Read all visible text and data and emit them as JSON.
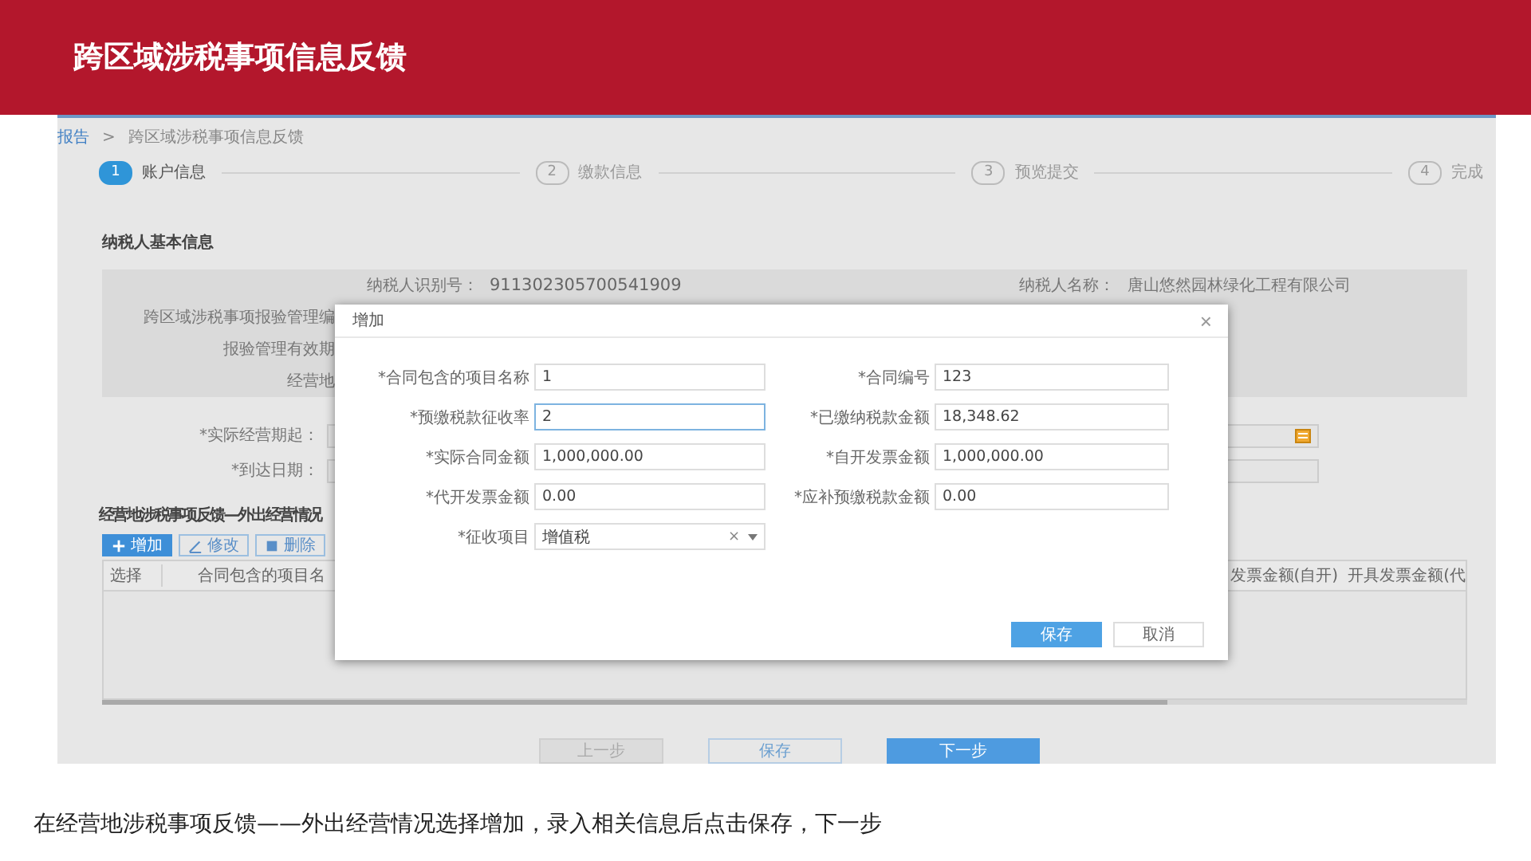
{
  "header": {
    "title": "跨区域涉税事项信息反馈"
  },
  "breadcrumb": {
    "parent": "报告",
    "separator": ">",
    "current": "跨区域涉税事项信息反馈"
  },
  "steps": [
    {
      "number": "1",
      "label": "账户信息",
      "selected": true
    },
    {
      "number": "2",
      "label": "缴款信息",
      "selected": false
    },
    {
      "number": "3",
      "label": "预览提交",
      "selected": false
    },
    {
      "number": "4",
      "label": "完成",
      "selected": false
    }
  ],
  "basic_info": {
    "title": "纳税人基本信息",
    "rows": [
      {
        "label": "纳税人识别号：",
        "value": "911302305700541909",
        "right_label": "纳税人名称：",
        "right_value": "唐山悠然园林绿化工程有限公司"
      },
      {
        "label": "跨区域涉税事项报验管理编"
      },
      {
        "label": "报验管理有效期"
      },
      {
        "label": "经营地"
      }
    ]
  },
  "date_fields": [
    {
      "label": "*实际经营期起：",
      "kind": "date"
    },
    {
      "label": "*到达日期：",
      "kind": "text"
    }
  ],
  "feedback": {
    "title": "经营地涉税事项反馈—外出经营情况",
    "toolbar": [
      {
        "label": "增加",
        "kind": "add"
      },
      {
        "label": "修改",
        "kind": "edit"
      },
      {
        "label": "删除",
        "kind": "delete"
      }
    ],
    "table": {
      "columns": [
        "选择",
        "合同包含的项目名",
        "发票金额(自开)",
        "开具发票金额(代"
      ]
    }
  },
  "footer_buttons": [
    {
      "label": "上一步",
      "kind": "secondary",
      "disabled": true
    },
    {
      "label": "保存",
      "kind": "secondary",
      "disabled": false
    },
    {
      "label": "下一步",
      "kind": "primary",
      "disabled": false
    }
  ],
  "dialog": {
    "title": "增加",
    "close": "×",
    "fields": [
      {
        "label": "*合同包含的项目名称",
        "value": "1",
        "kind": "input",
        "focused": false
      },
      {
        "label": "*合同编号",
        "value": "123",
        "kind": "input",
        "focused": false
      },
      {
        "label": "*预缴税款征收率",
        "value": "2",
        "kind": "input",
        "focused": true
      },
      {
        "label": "*已缴纳税款金额",
        "value": "18,348.62",
        "kind": "input",
        "focused": false
      },
      {
        "label": "*实际合同金额",
        "value": "1,000,000.00",
        "kind": "input",
        "focused": false
      },
      {
        "label": "*自开发票金额",
        "value": "1,000,000.00",
        "kind": "input",
        "focused": false
      },
      {
        "label": "*代开发票金额",
        "value": "0.00",
        "kind": "input",
        "focused": false
      },
      {
        "label": "*应补预缴税款金额",
        "value": "0.00",
        "kind": "input",
        "focused": false
      },
      {
        "label": "*征收项目",
        "value": "增值税",
        "kind": "select",
        "clear": "×",
        "focused": false
      }
    ],
    "buttons": [
      {
        "label": "保存",
        "kind": "primary"
      },
      {
        "label": "取消",
        "kind": "secondary"
      }
    ]
  },
  "caption": "在经营地涉税事项反馈——外出经营情况选择增加，录入相关信息后点击保存，下一步"
}
